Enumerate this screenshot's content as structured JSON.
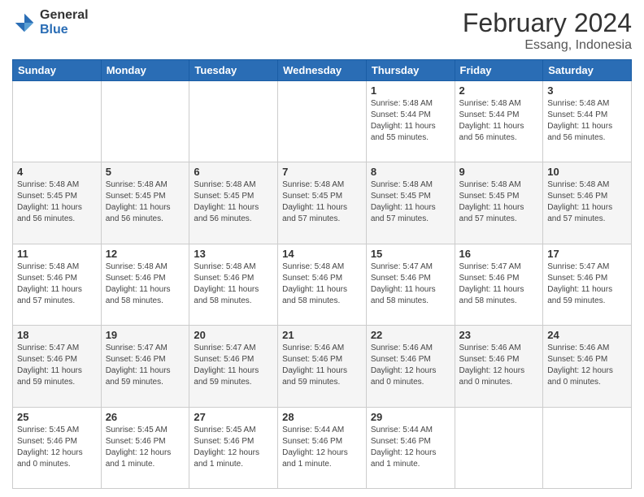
{
  "header": {
    "logo_general": "General",
    "logo_blue": "Blue",
    "month_title": "February 2024",
    "subtitle": "Essang, Indonesia"
  },
  "days_of_week": [
    "Sunday",
    "Monday",
    "Tuesday",
    "Wednesday",
    "Thursday",
    "Friday",
    "Saturday"
  ],
  "weeks": [
    [
      {
        "day": "",
        "info": ""
      },
      {
        "day": "",
        "info": ""
      },
      {
        "day": "",
        "info": ""
      },
      {
        "day": "",
        "info": ""
      },
      {
        "day": "1",
        "info": "Sunrise: 5:48 AM\nSunset: 5:44 PM\nDaylight: 11 hours and 55 minutes."
      },
      {
        "day": "2",
        "info": "Sunrise: 5:48 AM\nSunset: 5:44 PM\nDaylight: 11 hours and 56 minutes."
      },
      {
        "day": "3",
        "info": "Sunrise: 5:48 AM\nSunset: 5:44 PM\nDaylight: 11 hours and 56 minutes."
      }
    ],
    [
      {
        "day": "4",
        "info": "Sunrise: 5:48 AM\nSunset: 5:45 PM\nDaylight: 11 hours and 56 minutes."
      },
      {
        "day": "5",
        "info": "Sunrise: 5:48 AM\nSunset: 5:45 PM\nDaylight: 11 hours and 56 minutes."
      },
      {
        "day": "6",
        "info": "Sunrise: 5:48 AM\nSunset: 5:45 PM\nDaylight: 11 hours and 56 minutes."
      },
      {
        "day": "7",
        "info": "Sunrise: 5:48 AM\nSunset: 5:45 PM\nDaylight: 11 hours and 57 minutes."
      },
      {
        "day": "8",
        "info": "Sunrise: 5:48 AM\nSunset: 5:45 PM\nDaylight: 11 hours and 57 minutes."
      },
      {
        "day": "9",
        "info": "Sunrise: 5:48 AM\nSunset: 5:45 PM\nDaylight: 11 hours and 57 minutes."
      },
      {
        "day": "10",
        "info": "Sunrise: 5:48 AM\nSunset: 5:46 PM\nDaylight: 11 hours and 57 minutes."
      }
    ],
    [
      {
        "day": "11",
        "info": "Sunrise: 5:48 AM\nSunset: 5:46 PM\nDaylight: 11 hours and 57 minutes."
      },
      {
        "day": "12",
        "info": "Sunrise: 5:48 AM\nSunset: 5:46 PM\nDaylight: 11 hours and 58 minutes."
      },
      {
        "day": "13",
        "info": "Sunrise: 5:48 AM\nSunset: 5:46 PM\nDaylight: 11 hours and 58 minutes."
      },
      {
        "day": "14",
        "info": "Sunrise: 5:48 AM\nSunset: 5:46 PM\nDaylight: 11 hours and 58 minutes."
      },
      {
        "day": "15",
        "info": "Sunrise: 5:47 AM\nSunset: 5:46 PM\nDaylight: 11 hours and 58 minutes."
      },
      {
        "day": "16",
        "info": "Sunrise: 5:47 AM\nSunset: 5:46 PM\nDaylight: 11 hours and 58 minutes."
      },
      {
        "day": "17",
        "info": "Sunrise: 5:47 AM\nSunset: 5:46 PM\nDaylight: 11 hours and 59 minutes."
      }
    ],
    [
      {
        "day": "18",
        "info": "Sunrise: 5:47 AM\nSunset: 5:46 PM\nDaylight: 11 hours and 59 minutes."
      },
      {
        "day": "19",
        "info": "Sunrise: 5:47 AM\nSunset: 5:46 PM\nDaylight: 11 hours and 59 minutes."
      },
      {
        "day": "20",
        "info": "Sunrise: 5:47 AM\nSunset: 5:46 PM\nDaylight: 11 hours and 59 minutes."
      },
      {
        "day": "21",
        "info": "Sunrise: 5:46 AM\nSunset: 5:46 PM\nDaylight: 11 hours and 59 minutes."
      },
      {
        "day": "22",
        "info": "Sunrise: 5:46 AM\nSunset: 5:46 PM\nDaylight: 12 hours and 0 minutes."
      },
      {
        "day": "23",
        "info": "Sunrise: 5:46 AM\nSunset: 5:46 PM\nDaylight: 12 hours and 0 minutes."
      },
      {
        "day": "24",
        "info": "Sunrise: 5:46 AM\nSunset: 5:46 PM\nDaylight: 12 hours and 0 minutes."
      }
    ],
    [
      {
        "day": "25",
        "info": "Sunrise: 5:45 AM\nSunset: 5:46 PM\nDaylight: 12 hours and 0 minutes."
      },
      {
        "day": "26",
        "info": "Sunrise: 5:45 AM\nSunset: 5:46 PM\nDaylight: 12 hours and 1 minute."
      },
      {
        "day": "27",
        "info": "Sunrise: 5:45 AM\nSunset: 5:46 PM\nDaylight: 12 hours and 1 minute."
      },
      {
        "day": "28",
        "info": "Sunrise: 5:44 AM\nSunset: 5:46 PM\nDaylight: 12 hours and 1 minute."
      },
      {
        "day": "29",
        "info": "Sunrise: 5:44 AM\nSunset: 5:46 PM\nDaylight: 12 hours and 1 minute."
      },
      {
        "day": "",
        "info": ""
      },
      {
        "day": "",
        "info": ""
      }
    ]
  ]
}
